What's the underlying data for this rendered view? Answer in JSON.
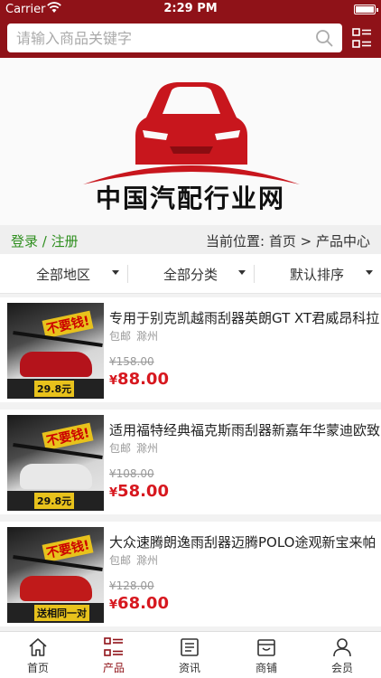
{
  "status_bar": {
    "carrier": "Carrier",
    "time": "2:29 PM"
  },
  "search": {
    "placeholder": "请输入商品关键字",
    "icon": "search-icon",
    "menu_icon": "category-menu-icon"
  },
  "banner": {
    "logo_text": "中国汽配行业网",
    "logo_color": "#c8161d"
  },
  "breadcrumb": {
    "login": "登录",
    "separator": "/",
    "register": "注册",
    "current_label": "当前位置:",
    "home": "首页",
    "arrow": ">",
    "current": "产品中心"
  },
  "filters": [
    {
      "label": "全部地区"
    },
    {
      "label": "全部分类"
    },
    {
      "label": "默认排序"
    }
  ],
  "products": [
    {
      "title": "专用于别克凯越雨刮器英朗GT XT君威昂科拉",
      "shipping": "包邮",
      "city": "滁州",
      "original_price": "¥158.00",
      "currency": "¥",
      "price": "88.00",
      "thumb_badge": "不要钱!",
      "thumb_price": "29.8元",
      "car_color": "#b4131b"
    },
    {
      "title": "适用福特经典福克斯雨刮器新嘉年华蒙迪欧致",
      "shipping": "包邮",
      "city": "滁州",
      "original_price": "¥108.00",
      "currency": "¥",
      "price": "58.00",
      "thumb_badge": "不要钱!",
      "thumb_price": "29.8元",
      "car_color": "#e8e8e8"
    },
    {
      "title": "大众速腾朗逸雨刮器迈腾POLO途观新宝来帕",
      "shipping": "包邮",
      "city": "滁州",
      "original_price": "¥128.00",
      "currency": "¥",
      "price": "68.00",
      "thumb_badge": "不要钱!",
      "thumb_price": "送相同一对",
      "car_color": "#c01a1a"
    }
  ],
  "tabs": [
    {
      "label": "首页",
      "icon": "home-icon",
      "active": false
    },
    {
      "label": "产品",
      "icon": "product-list-icon",
      "active": true
    },
    {
      "label": "资讯",
      "icon": "news-icon",
      "active": false
    },
    {
      "label": "商铺",
      "icon": "shop-icon",
      "active": false
    },
    {
      "label": "会员",
      "icon": "member-icon",
      "active": false
    }
  ],
  "colors": {
    "brand": "#8f1218",
    "price": "#d7181f",
    "login": "#2f8f1f"
  }
}
